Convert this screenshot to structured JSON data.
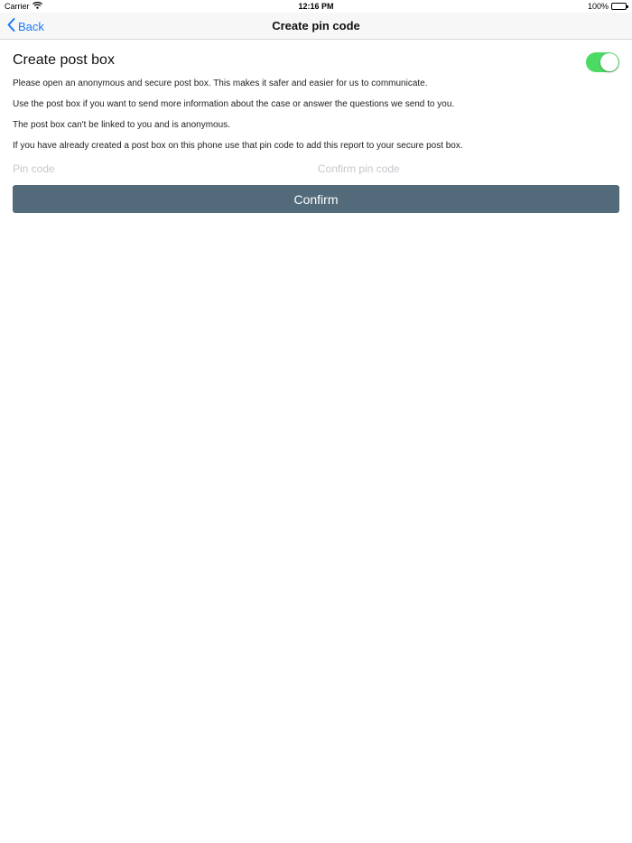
{
  "status": {
    "carrier": "Carrier",
    "time": "12:16 PM",
    "battery": "100%",
    "wifi_icon": "wifi-icon",
    "battery_icon": "battery-icon"
  },
  "nav": {
    "back_label": "Back",
    "back_icon": "chevron-left-icon",
    "title": "Create pin code",
    "accent": "#1b7cf5"
  },
  "section": {
    "title": "Create post box",
    "toggle_on": true,
    "toggle_color": "#4cd964"
  },
  "paragraphs": [
    "Please open an anonymous and secure post box. This makes it safer and easier for us to communicate.",
    "Use the post box if you want to send more information about the case or answer the questions we send to you.",
    "The post box can't be linked to you and is anonymous.",
    "If you have already created a post box on this phone use that pin code to add this report to your secure post box."
  ],
  "form": {
    "pin_placeholder": "Pin code",
    "pin_value": "",
    "confirm_pin_placeholder": "Confirm pin code",
    "confirm_pin_value": "",
    "confirm_label": "Confirm",
    "confirm_color": "#526a79"
  }
}
